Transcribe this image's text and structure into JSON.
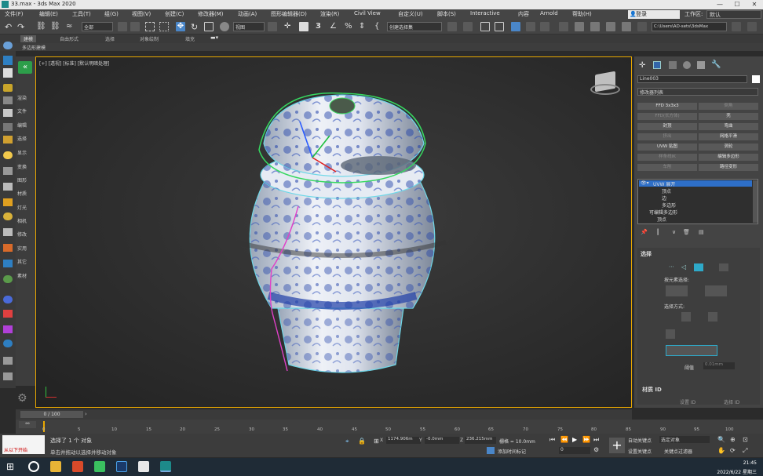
{
  "window": {
    "title": "33.max - 3ds Max 2020",
    "controls": [
      "—",
      "☐",
      "✕"
    ]
  },
  "menu": {
    "items": [
      "文件(F)",
      "编辑(E)",
      "工具(T)",
      "组(G)",
      "视图(V)",
      "创建(C)",
      "修改器(M)",
      "动画(A)",
      "图形编辑器(D)",
      "渲染(R)",
      "Civil View",
      "自定义(U)",
      "脚本(S)",
      "Interactive",
      "内容",
      "Arnold",
      "帮助(H)"
    ],
    "login": "登录",
    "workspace_label": "工作区:",
    "workspace_value": "默认"
  },
  "toolbar": {
    "selection_filter": "全部",
    "view_coord": "视图",
    "named_selection": "创建选择集",
    "path": "C:\\Users\\AD-sets\\3dsMax"
  },
  "ribbon": {
    "tabs": [
      "建模",
      "自由形式",
      "选择",
      "对象绘制",
      "填充"
    ]
  },
  "subribbon": {
    "label": "多边形建模"
  },
  "command_panel_left": {
    "items": [
      "渲染",
      "文件",
      "编辑",
      "选择",
      "显示",
      "变换",
      "图形",
      "材质",
      "灯光",
      "相机",
      "修改",
      "实用",
      "其它",
      "素材"
    ]
  },
  "viewport": {
    "label": "[+] [透视] [标准] [默认明暗处理]"
  },
  "modify_panel": {
    "object_name": "Line003",
    "modifier_list": "修改器列表",
    "buttons": [
      [
        "FFD 3x3x3",
        "倒角"
      ],
      [
        "FFD(长方体)",
        "壳"
      ],
      [
        "封顶",
        "弯曲"
      ],
      [
        "挤出",
        "网格平滑"
      ],
      [
        "UVW 贴图",
        "涡轮"
      ],
      [
        "样条线IK",
        "编辑多边形"
      ],
      [
        "车削",
        "路径变形"
      ]
    ],
    "stack": {
      "items": [
        "UVW 展开",
        "顶点",
        "边",
        "多边形",
        "可编辑多边形",
        "顶点"
      ]
    },
    "rollout_select": "选择",
    "by_element": "按元素选择:",
    "sel_method": "选择方式:",
    "threshold_label": "阈值",
    "threshold_value": "0.01mm",
    "rollout_material": "材质 ID",
    "set_id": "设置 ID",
    "select_id": "选择 ID"
  },
  "timeline": {
    "frame": "0 / 100",
    "ticks": [
      "0",
      "5",
      "10",
      "15",
      "20",
      "25",
      "30",
      "35",
      "40",
      "45",
      "50",
      "55",
      "60",
      "65",
      "70",
      "75",
      "80",
      "85",
      "90",
      "95",
      "100"
    ]
  },
  "status": {
    "selected": "选择了 1 个 对象",
    "hint": "单击并拖动以选择并移动对象",
    "x": "1174.906m",
    "y": "-0.0mm",
    "z": "236.215mm",
    "grid": "栅格 = 10.0mm",
    "add_time_tag": "添加时间标记",
    "auto_key": "自动关键点",
    "selected_obj": "选定对象",
    "set_key": "设置关键点",
    "key_filter": "关键点过滤器",
    "frame_field": "0",
    "start_label": "从以下开始"
  },
  "taskbar": {
    "time": "21:45",
    "date": "2022/6/22 星期三"
  },
  "colors": {
    "accent_orange": "#e9a800",
    "active_blue": "#4a86c8",
    "selected_teal": "#2ea9c9"
  }
}
